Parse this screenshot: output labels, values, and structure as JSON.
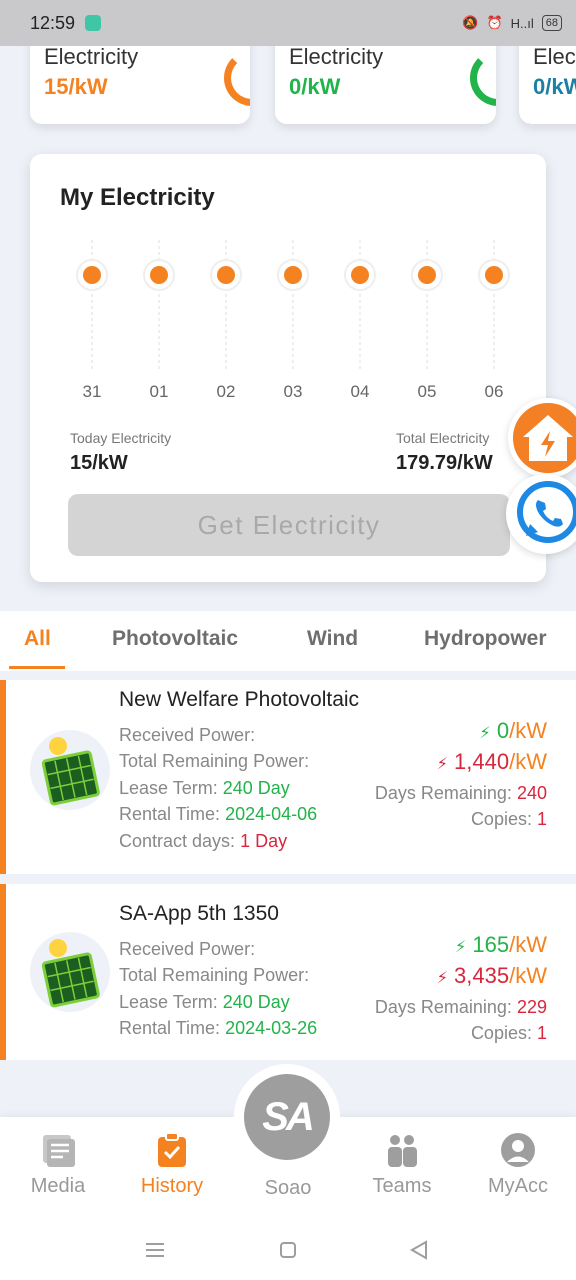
{
  "status_bar": {
    "time": "12:59",
    "network": "H..ıl",
    "battery": "68"
  },
  "summary_cards": [
    {
      "label": "Electricity",
      "value": "15/kW",
      "color": "#f58220",
      "ring_color": "#f58220"
    },
    {
      "label": "Electricity",
      "value": "0/kW",
      "color": "#22b34a",
      "ring_color": "#22b34a"
    },
    {
      "label": "Elec",
      "value": "0/kW",
      "color": "#1d7fa5"
    }
  ],
  "my_electricity": {
    "title": "My Electricity",
    "days": [
      "31",
      "01",
      "02",
      "03",
      "04",
      "05",
      "06"
    ],
    "today_label": "Today Electricity",
    "today_value": "15/kW",
    "total_label": "Total Electricity",
    "total_value": "179.79/kW",
    "button_label": "Get Electricity"
  },
  "tabs": [
    {
      "label": "All",
      "active": true
    },
    {
      "label": "Photovoltaic",
      "active": false
    },
    {
      "label": "Wind",
      "active": false
    },
    {
      "label": "Hydropower",
      "active": false
    }
  ],
  "items": [
    {
      "name": "New Welfare Photovoltaic",
      "received_label": "Received Power:",
      "remaining_label": "Total Remaining Power:",
      "lease_label": "Lease Term:",
      "lease_value": "240 Day",
      "rental_label": "Rental Time:",
      "rental_value": "2024-04-06",
      "contract_label": "Contract days:",
      "contract_value": "1 Day",
      "received_value": "0",
      "remaining_value": "1,440",
      "unit": "/kW",
      "days_remaining_label": "Days Remaining:",
      "days_remaining_value": "240",
      "copies_label": "Copies:",
      "copies_value": "1"
    },
    {
      "name": "SA-App 5th 1350",
      "received_label": "Received Power:",
      "remaining_label": "Total Remaining Power:",
      "lease_label": "Lease Term:",
      "lease_value": "240 Day",
      "rental_label": "Rental Time:",
      "rental_value": "2024-03-26",
      "received_value": "165",
      "remaining_value": "3,435",
      "unit": "/kW",
      "days_remaining_label": "Days Remaining:",
      "days_remaining_value": "229",
      "copies_label": "Copies:",
      "copies_value": "1"
    }
  ],
  "bottom_nav": {
    "media": "Media",
    "history": "History",
    "center_logo": "SA",
    "center_label": "Soao",
    "teams": "Teams",
    "myacc": "MyAcc"
  },
  "colors": {
    "accent": "#f58220",
    "green": "#22b34a",
    "red": "#d7263d"
  }
}
